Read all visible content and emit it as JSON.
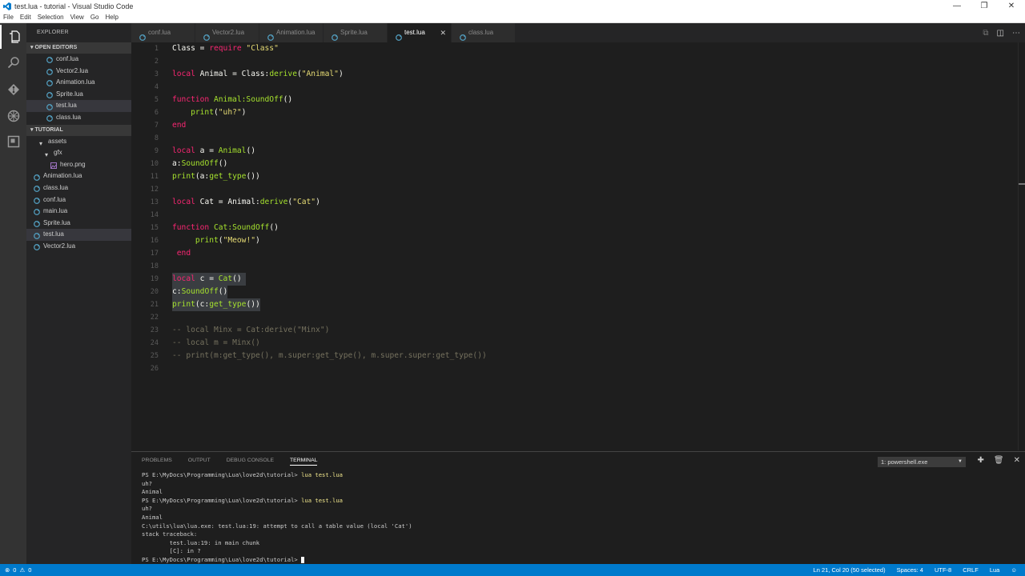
{
  "window": {
    "title": "test.lua - tutorial - Visual Studio Code"
  },
  "menu": [
    "File",
    "Edit",
    "Selection",
    "View",
    "Go",
    "Help"
  ],
  "sidebar": {
    "header": "EXPLORER",
    "open_editors_label": "OPEN EDITORS",
    "open_editors": [
      "conf.lua",
      "Vector2.lua",
      "Animation.lua",
      "Sprite.lua",
      "test.lua",
      "class.lua"
    ],
    "project_label": "TUTORIAL",
    "tree": [
      {
        "label": "assets",
        "type": "folder",
        "indent": 1
      },
      {
        "label": "gfx",
        "type": "folder",
        "indent": 2
      },
      {
        "label": "hero.png",
        "type": "image",
        "indent": 3
      },
      {
        "label": "Animation.lua",
        "type": "lua",
        "indent": 0
      },
      {
        "label": "class.lua",
        "type": "lua",
        "indent": 0
      },
      {
        "label": "conf.lua",
        "type": "lua",
        "indent": 0
      },
      {
        "label": "main.lua",
        "type": "lua",
        "indent": 0
      },
      {
        "label": "Sprite.lua",
        "type": "lua",
        "indent": 0
      },
      {
        "label": "test.lua",
        "type": "lua",
        "indent": 0
      },
      {
        "label": "Vector2.lua",
        "type": "lua",
        "indent": 0
      }
    ]
  },
  "tabs": [
    "conf.lua",
    "Vector2.lua",
    "Animation.lua",
    "Sprite.lua",
    "test.lua",
    "class.lua"
  ],
  "active_tab": "test.lua",
  "code_lines": [
    [
      [
        "",
        "Class = "
      ],
      [
        "kw",
        "require"
      ],
      [
        "str",
        " \"Class\""
      ]
    ],
    [],
    [
      [
        "kw",
        "local"
      ],
      [
        "",
        " Animal = Class:"
      ],
      [
        "fn",
        "derive"
      ],
      [
        "",
        "("
      ],
      [
        "str",
        "\"Animal\""
      ],
      [
        "",
        ")"
      ]
    ],
    [],
    [
      [
        "kw",
        "function"
      ],
      [
        "",
        " "
      ],
      [
        "fn",
        "Animal:SoundOff"
      ],
      [
        "",
        "()"
      ]
    ],
    [
      [
        "",
        "    "
      ],
      [
        "fn",
        "print"
      ],
      [
        "",
        "("
      ],
      [
        "str",
        "\"uh?\""
      ],
      [
        "",
        ")"
      ]
    ],
    [
      [
        "kw",
        "end"
      ]
    ],
    [],
    [
      [
        "kw",
        "local"
      ],
      [
        "",
        " a = "
      ],
      [
        "fn",
        "Animal"
      ],
      [
        "",
        "()"
      ]
    ],
    [
      [
        "",
        "a:"
      ],
      [
        "fn",
        "SoundOff"
      ],
      [
        "",
        "()"
      ]
    ],
    [
      [
        "fn",
        "print"
      ],
      [
        "",
        "(a:"
      ],
      [
        "fn",
        "get_type"
      ],
      [
        "",
        "())"
      ]
    ],
    [],
    [
      [
        "kw",
        "local"
      ],
      [
        "",
        " Cat = Animal:"
      ],
      [
        "fn",
        "derive"
      ],
      [
        "",
        "("
      ],
      [
        "str",
        "\"Cat\""
      ],
      [
        "",
        ")"
      ]
    ],
    [],
    [
      [
        "kw",
        "function"
      ],
      [
        "",
        " "
      ],
      [
        "fn",
        "Cat:SoundOff"
      ],
      [
        "",
        "()"
      ]
    ],
    [
      [
        "",
        "     "
      ],
      [
        "fn",
        "print"
      ],
      [
        "",
        "("
      ],
      [
        "str",
        "\"Meow!\""
      ],
      [
        "",
        ")"
      ]
    ],
    [
      [
        "",
        " "
      ],
      [
        "kw",
        "end"
      ]
    ],
    [],
    [
      [
        "kw",
        "local"
      ],
      [
        "",
        " c = "
      ],
      [
        "fn",
        "Cat"
      ],
      [
        "",
        "() "
      ]
    ],
    [
      [
        "",
        "c:"
      ],
      [
        "fn",
        "SoundOff"
      ],
      [
        "",
        "()"
      ]
    ],
    [
      [
        "fn",
        "print"
      ],
      [
        "",
        "(c:"
      ],
      [
        "fn",
        "get_type"
      ],
      [
        "",
        "())"
      ]
    ],
    [],
    [
      [
        "cm",
        "-- local Minx = Cat:derive(\"Minx\")"
      ]
    ],
    [
      [
        "cm",
        "-- local m = Minx()"
      ]
    ],
    [
      [
        "cm",
        "-- print(m:get_type(), m.super:get_type(), m.super.super:get_type())"
      ]
    ],
    []
  ],
  "panel": {
    "tabs": [
      "PROBLEMS",
      "OUTPUT",
      "DEBUG CONSOLE",
      "TERMINAL"
    ],
    "active_tab": "TERMINAL",
    "terminal_select": "1: powershell.exe",
    "terminal_lines": [
      {
        "prompt": "PS E:\\MyDocs\\Programming\\Lua\\love2d\\tutorial> ",
        "cmd": "lua test.lua"
      },
      {
        "text": "uh?"
      },
      {
        "text": "Animal"
      },
      {
        "prompt": "PS E:\\MyDocs\\Programming\\Lua\\love2d\\tutorial> ",
        "cmd": "lua test.lua"
      },
      {
        "text": "uh?"
      },
      {
        "text": "Animal"
      },
      {
        "text": "C:\\utils\\lua\\lua.exe: test.lua:19: attempt to call a table value (local 'Cat')"
      },
      {
        "text": "stack traceback:"
      },
      {
        "text": "        test.lua:19: in main chunk"
      },
      {
        "text": "        [C]: in ?"
      },
      {
        "prompt": "PS E:\\MyDocs\\Programming\\Lua\\love2d\\tutorial> ",
        "cmd": "",
        "cursor": true
      }
    ]
  },
  "status": {
    "errors": "0",
    "warnings": "0",
    "position": "Ln 21, Col 20 (50 selected)",
    "spaces": "Spaces: 4",
    "encoding": "UTF-8",
    "eol": "CRLF",
    "language": "Lua"
  },
  "colors": {
    "accent": "#007acc",
    "lua_icon": "#519aba",
    "keyword": "#f92672",
    "string": "#e6db74",
    "function": "#a6e22e",
    "comment": "#75715e"
  }
}
